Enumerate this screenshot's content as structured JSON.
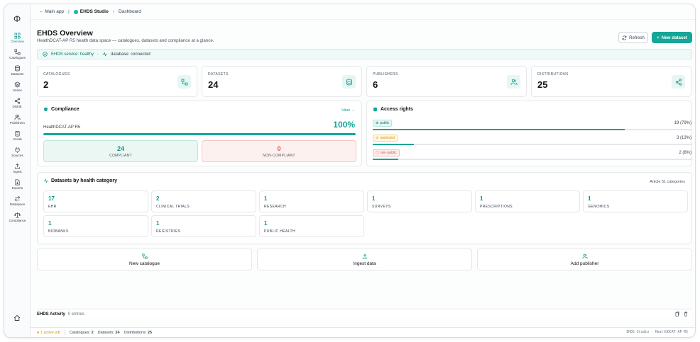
{
  "breadcrumb": {
    "back": "Main app",
    "studio": "EHDS Studio",
    "current": "Dashboard"
  },
  "header": {
    "title": "EHDS Overview",
    "subtitle": "HealthDCAT-AP R5 health data space — catalogues, datasets and compliance at a glance.",
    "refresh": "Refresh",
    "new_dataset": "New dataset"
  },
  "status": {
    "service": "EHDS service: healthy",
    "sep": "·",
    "database": "database: connected"
  },
  "sidebar": {
    "items": [
      "Overview",
      "Catalogues",
      "Datasets",
      "Series",
      "Distrib.",
      "Publishers",
      "Vocab",
      "Sources",
      "Ingest",
      "Exports",
      "Dataspace",
      "Compliance"
    ]
  },
  "stats": [
    {
      "label": "CATALOGUES",
      "value": "2",
      "icon": "catalogue-icon"
    },
    {
      "label": "DATASETS",
      "value": "24",
      "icon": "database-icon"
    },
    {
      "label": "PUBLISHERS",
      "value": "6",
      "icon": "users-icon"
    },
    {
      "label": "DISTRIBUTIONS",
      "value": "25",
      "icon": "share-icon"
    }
  ],
  "compliance": {
    "title": "Compliance",
    "view": "View →",
    "profile": "HealthDCAT-AP R5",
    "percent": "100%",
    "fraction": 1.0,
    "compliant": {
      "value": "24",
      "label": "COMPLIANT"
    },
    "noncompliant": {
      "value": "0",
      "label": "NON-COMPLIANT"
    }
  },
  "access": {
    "title": "Access rights",
    "rows": [
      {
        "tag": "public",
        "count": "19 (79%)",
        "fraction": 0.79
      },
      {
        "tag": "restricted",
        "count": "3 (13%)",
        "fraction": 0.13
      },
      {
        "tag": "non-public",
        "count": "2 (8%)",
        "fraction": 0.08
      }
    ]
  },
  "categories": {
    "title": "Datasets by health category",
    "article": "Article 51 categories",
    "items": [
      {
        "n": "17",
        "t": "EHR"
      },
      {
        "n": "2",
        "t": "CLINICAL TRIALS"
      },
      {
        "n": "1",
        "t": "RESEARCH"
      },
      {
        "n": "1",
        "t": "SURVEYS"
      },
      {
        "n": "1",
        "t": "PRESCRIPTIONS"
      },
      {
        "n": "1",
        "t": "GENOMICS"
      },
      {
        "n": "1",
        "t": "BIOBANKS"
      },
      {
        "n": "1",
        "t": "REGISTRIES"
      },
      {
        "n": "1",
        "t": "PUBLIC HEALTH"
      }
    ]
  },
  "actions": [
    "New catalogue",
    "Ingest data",
    "Add publisher"
  ],
  "activity": {
    "title": "EHDS Activity",
    "entries": "0 entries"
  },
  "footer": {
    "job": "1 active job",
    "catalogues": "Catalogues:",
    "catalogues_n": "2",
    "datasets": "Datasets:",
    "datasets_n": "24",
    "distributions": "Distributions:",
    "distributions_n": "25",
    "right": "EHDS Studio · HealthDCAT-AP R5"
  },
  "colors": {
    "accent": "#14a697",
    "danger": "#e0524a",
    "warning": "#d98e04"
  }
}
